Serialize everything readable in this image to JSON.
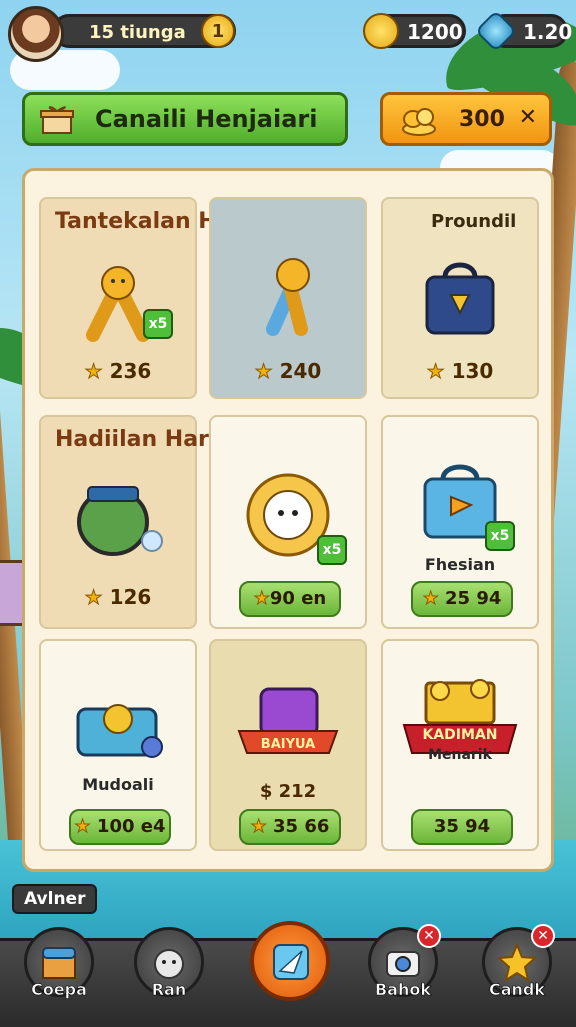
{
  "topbar": {
    "player_name": "15 tiunga",
    "level": "1",
    "gold": "1200",
    "gems": "1.20"
  },
  "header": {
    "title": "Canaili Henjaiari",
    "coin_amount": "300",
    "close_symbol": "✕"
  },
  "cards": [
    {
      "title": "Tantekalan Harian",
      "price": "236",
      "badge": "x5"
    },
    {
      "price": "240"
    },
    {
      "title": "Proundil",
      "price": "130"
    },
    {
      "title": "Hadiilan Harian",
      "price": "126"
    },
    {
      "price": "90 en",
      "badge": "x5"
    },
    {
      "subtitle": "Fhesian",
      "price": "25 94",
      "badge": "x5"
    },
    {
      "subtitle": "Mudoali",
      "price": "100 e4"
    },
    {
      "price": "$ 212",
      "banner": "BAIYUA",
      "price2": "35 66"
    },
    {
      "banner": "KADIMAN",
      "banner2": "Menarik",
      "price": "35 94"
    }
  ],
  "partner_label": "Avlner",
  "nav": [
    {
      "label": "Coepa"
    },
    {
      "label": "Ran"
    },
    {
      "label": ""
    },
    {
      "label": "Bahok",
      "notif": "✕"
    },
    {
      "label": "Candk",
      "notif": "✕"
    }
  ],
  "colors": {
    "accent_green": "#4fae2c",
    "accent_orange": "#f29411",
    "panel_bg": "#fbf3df"
  }
}
